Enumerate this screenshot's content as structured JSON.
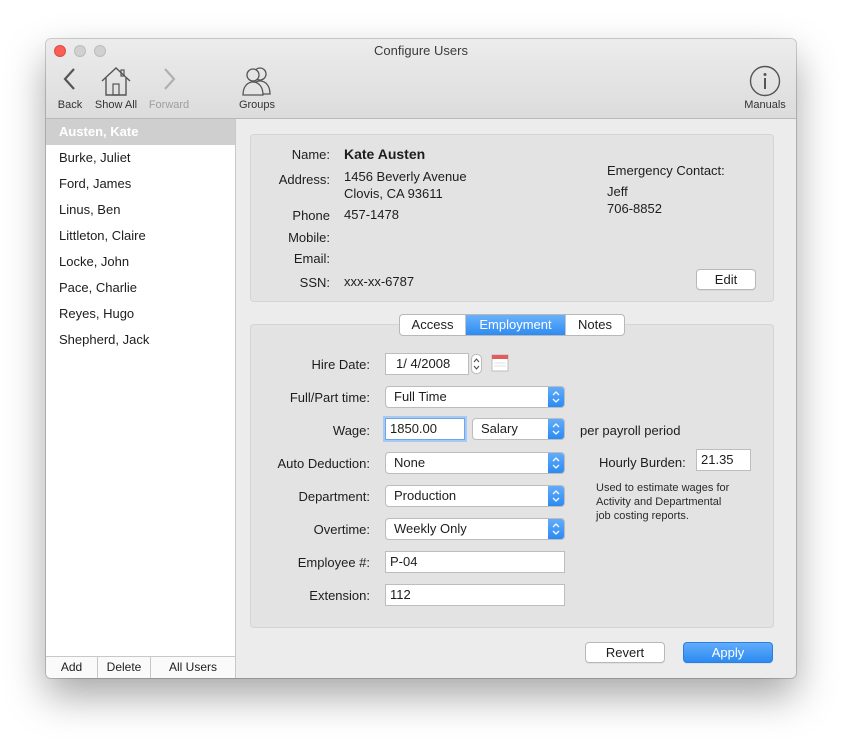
{
  "window": {
    "title": "Configure Users"
  },
  "toolbar": {
    "back": "Back",
    "show_all": "Show All",
    "forward": "Forward",
    "groups": "Groups",
    "manuals": "Manuals"
  },
  "users": [
    "Austen, Kate",
    "Burke, Juliet",
    "Ford, James",
    "Linus, Ben",
    "Littleton, Claire",
    "Locke, John",
    "Pace, Charlie",
    "Reyes, Hugo",
    "Shepherd, Jack"
  ],
  "sidebar_buttons": {
    "add": "Add",
    "delete": "Delete",
    "all_users": "All Users"
  },
  "contact": {
    "name_label": "Name:",
    "name": "Kate Austen",
    "address_label": "Address:",
    "address_line1": "1456 Beverly Avenue",
    "address_line2": "Clovis, CA 93611",
    "phone_label": "Phone",
    "phone": "457-1478",
    "mobile_label": "Mobile:",
    "email_label": "Email:",
    "ssn_label": "SSN:",
    "ssn": "xxx-xx-6787",
    "emergency_label": "Emergency Contact:",
    "emergency_name": "Jeff",
    "emergency_phone": "706-8852",
    "edit": "Edit"
  },
  "tabs": [
    {
      "label": "Access",
      "active": false
    },
    {
      "label": "Employment",
      "active": true
    },
    {
      "label": "Notes",
      "active": false
    }
  ],
  "employment": {
    "hire_date_label": "Hire Date:",
    "hire_date": "1/  4/2008",
    "full_part_label": "Full/Part time:",
    "full_part": "Full Time",
    "wage_label": "Wage:",
    "wage": "1850.00",
    "wage_type": "Salary",
    "per_payroll": "per payroll period",
    "auto_deduction_label": "Auto Deduction:",
    "auto_deduction": "None",
    "department_label": "Department:",
    "department": "Production",
    "overtime_label": "Overtime:",
    "overtime": "Weekly Only",
    "employee_no_label": "Employee #:",
    "employee_no": "P-04",
    "extension_label": "Extension:",
    "extension": "112",
    "hourly_burden_label": "Hourly Burden:",
    "hourly_burden": "21.35",
    "burden_note_1": "Used to estimate wages for",
    "burden_note_2": "Activity and Departmental",
    "burden_note_3": "job costing reports."
  },
  "footer": {
    "revert": "Revert",
    "apply": "Apply"
  },
  "colors": {
    "accent": "#2b8bf2",
    "close": "#fc5f57"
  }
}
